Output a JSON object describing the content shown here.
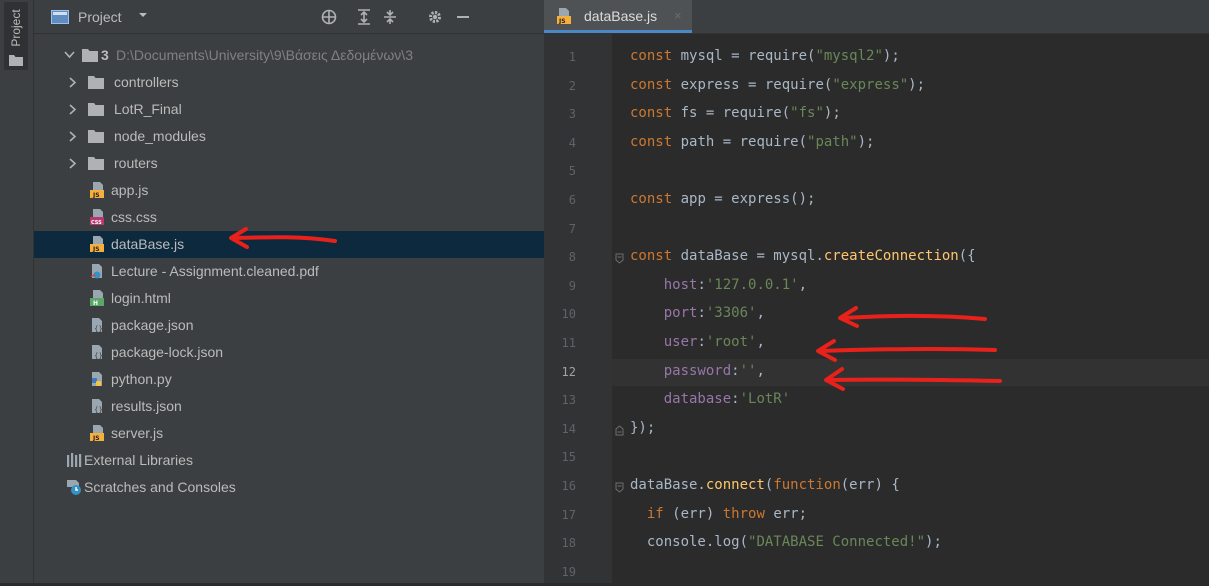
{
  "sidebar_stripe": {
    "label": "Project"
  },
  "project_panel": {
    "title": "Project",
    "tree": [
      {
        "kind": "root",
        "name": "3",
        "path": "D:\\Documents\\University\\9\\Βάσεις Δεδομένων\\3",
        "icon": "folder-icon"
      },
      {
        "kind": "folder",
        "name": "controllers",
        "icon": "folder-icon"
      },
      {
        "kind": "folder",
        "name": "LotR_Final",
        "icon": "folder-icon"
      },
      {
        "kind": "folder",
        "name": "node_modules",
        "icon": "folder-icon"
      },
      {
        "kind": "folder",
        "name": "routers",
        "icon": "folder-icon"
      },
      {
        "kind": "file",
        "name": "app.js",
        "icon": "js-file-icon"
      },
      {
        "kind": "file",
        "name": "css.css",
        "icon": "css-file-icon"
      },
      {
        "kind": "file",
        "name": "dataBase.js",
        "icon": "js-file-icon",
        "selected": true
      },
      {
        "kind": "file",
        "name": "Lecture - Assignment.cleaned.pdf",
        "icon": "pdf-file-icon"
      },
      {
        "kind": "file",
        "name": "login.html",
        "icon": "html-file-icon"
      },
      {
        "kind": "file",
        "name": "package.json",
        "icon": "json-file-icon"
      },
      {
        "kind": "file",
        "name": "package-lock.json",
        "icon": "json-file-icon"
      },
      {
        "kind": "file",
        "name": "python.py",
        "icon": "python-file-icon"
      },
      {
        "kind": "file",
        "name": "results.json",
        "icon": "json-file-icon"
      },
      {
        "kind": "file",
        "name": "server.js",
        "icon": "js-file-icon"
      },
      {
        "kind": "special",
        "name": "External Libraries",
        "icon": "libraries-icon"
      },
      {
        "kind": "special",
        "name": "Scratches and Consoles",
        "icon": "scratches-icon"
      }
    ]
  },
  "editor": {
    "tab": {
      "label": "dataBase.js",
      "close": "×",
      "icon": "js-file-icon"
    },
    "current_line": 12,
    "lines": [
      {
        "n": "1",
        "text": "const mysql = require(\"mysql2\");"
      },
      {
        "n": "2",
        "text": "const express = require(\"express\");"
      },
      {
        "n": "3",
        "text": "const fs = require(\"fs\");"
      },
      {
        "n": "4",
        "text": "const path = require(\"path\");"
      },
      {
        "n": "5",
        "text": ""
      },
      {
        "n": "6",
        "text": "const app = express();"
      },
      {
        "n": "7",
        "text": ""
      },
      {
        "n": "8",
        "text": "const dataBase = mysql.createConnection({"
      },
      {
        "n": "9",
        "text": "    host:'127.0.0.1',"
      },
      {
        "n": "10",
        "text": "    port:'3306',"
      },
      {
        "n": "11",
        "text": "    user:'root',"
      },
      {
        "n": "12",
        "text": "    password:'',"
      },
      {
        "n": "13",
        "text": "    database:'LotR'"
      },
      {
        "n": "14",
        "text": "});"
      },
      {
        "n": "15",
        "text": ""
      },
      {
        "n": "16",
        "text": "dataBase.connect(function(err) {"
      },
      {
        "n": "17",
        "text": "  if (err) throw err;"
      },
      {
        "n": "18",
        "text": "  console.log(\"DATABASE Connected!\");"
      },
      {
        "n": "19",
        "text": ""
      }
    ]
  },
  "colors": {
    "keyword": "#cc7832",
    "string": "#6a8759",
    "function": "#ffc66d",
    "property": "#9876aa",
    "text": "#a9b7c6",
    "annotation_arrow": "#e8211b"
  }
}
